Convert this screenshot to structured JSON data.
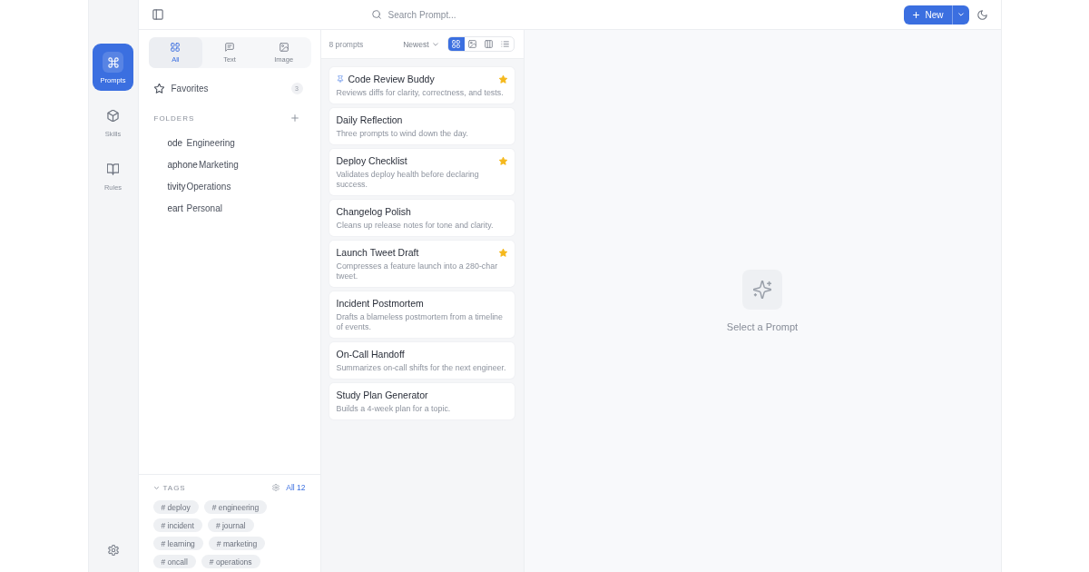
{
  "rail": {
    "items": [
      {
        "kind": "prompts",
        "label": "Prompts",
        "selected": true
      },
      {
        "kind": "skills",
        "label": "Skills",
        "selected": false
      },
      {
        "kind": "rules",
        "label": "Rules",
        "selected": false
      }
    ]
  },
  "top_bar": {
    "search": {
      "placeholder": "Search Prompt..."
    },
    "new_button": {
      "label": "New"
    }
  },
  "sidebar": {
    "type_tabs": [
      {
        "kind": "all",
        "label": "All",
        "selected": true
      },
      {
        "kind": "text",
        "label": "Text",
        "selected": false
      },
      {
        "kind": "image",
        "label": "Image",
        "selected": false
      }
    ],
    "favorites": {
      "label": "Favorites",
      "count": "3"
    },
    "folders": {
      "heading": "FOLDERS",
      "items": [
        {
          "icon_text": "ode",
          "label": "Engineering"
        },
        {
          "icon_text": "aphone",
          "label": "Marketing"
        },
        {
          "icon_text": "tivity",
          "label": "Operations"
        },
        {
          "icon_text": "eart",
          "label": "Personal"
        }
      ]
    },
    "tags": {
      "heading": "TAGS",
      "expanded": true,
      "all_link": "All 12",
      "items": [
        "# deploy",
        "# engineering",
        "# incident",
        "# journal",
        "# learning",
        "# marketing",
        "# oncall",
        "# operations"
      ]
    }
  },
  "prompt_list": {
    "count": "8 prompts",
    "sort": "Newest",
    "views": [
      {
        "kind": "grid",
        "selected": true
      },
      {
        "kind": "gallery",
        "selected": false
      },
      {
        "kind": "columns",
        "selected": false
      },
      {
        "kind": "list",
        "selected": false
      }
    ],
    "prompts": [
      {
        "title": "Code Review Buddy",
        "description": "Reviews diffs for clarity, correctness, and tests.",
        "pinned": true,
        "favorite": true
      },
      {
        "title": "Daily Reflection",
        "description": "Three prompts to wind down the day.",
        "pinned": false,
        "favorite": false
      },
      {
        "title": "Deploy Checklist",
        "description": "Validates deploy health before declaring success.",
        "pinned": false,
        "favorite": true
      },
      {
        "title": "Changelog Polish",
        "description": "Cleans up release notes for tone and clarity.",
        "pinned": false,
        "favorite": false
      },
      {
        "title": "Launch Tweet Draft",
        "description": "Compresses a feature launch into a 280-char tweet.",
        "pinned": false,
        "favorite": true
      },
      {
        "title": "Incident Postmortem",
        "description": "Drafts a blameless postmortem from a timeline of events.",
        "pinned": false,
        "favorite": false
      },
      {
        "title": "On-Call Handoff",
        "description": "Summarizes on-call shifts for the next engineer.",
        "pinned": false,
        "favorite": false
      },
      {
        "title": "Study Plan Generator",
        "description": "Builds a 4-week plan for a topic.",
        "pinned": false,
        "favorite": false
      }
    ]
  },
  "detail": {
    "empty_text": "Select a Prompt"
  }
}
